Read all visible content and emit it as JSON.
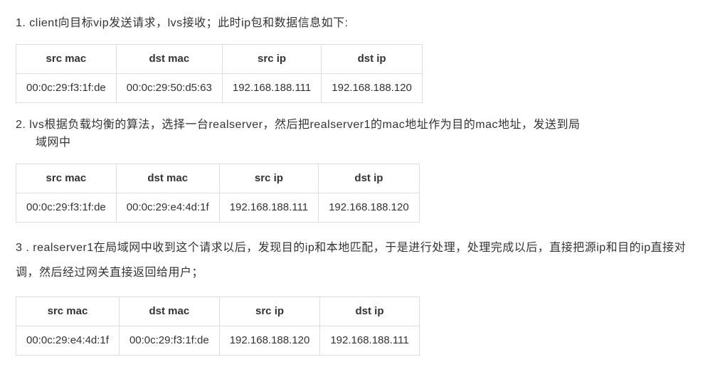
{
  "steps": [
    {
      "text": "1. client向目标vip发送请求，lvs接收；此时ip包和数据信息如下:",
      "text2": "",
      "headers": [
        "src mac",
        "dst mac",
        "src ip",
        "dst ip"
      ],
      "row": [
        "00:0c:29:f3:1f:de",
        "00:0c:29:50:d5:63",
        "192.168.188.111",
        "192.168.188.120"
      ]
    },
    {
      "text": "2. lvs根据负载均衡的算法，选择一台realserver，然后把realserver1的mac地址作为目的mac地址，发送到局",
      "text2": "域网中",
      "headers": [
        "src mac",
        "dst mac",
        "src ip",
        "dst ip"
      ],
      "row": [
        "00:0c:29:f3:1f:de",
        "00:0c:29:e4:4d:1f",
        "192.168.188.111",
        "192.168.188.120"
      ]
    },
    {
      "text": "3 . realserver1在局域网中收到这个请求以后，发现目的ip和本地匹配，于是进行处理，处理完成以后，直接把源ip和目的ip直接对调，然后经过网关直接返回给用户；",
      "text2": "",
      "headers": [
        "src mac",
        "dst mac",
        "src ip",
        "dst ip"
      ],
      "row": [
        "00:0c:29:e4:4d:1f",
        "00:0c:29:f3:1f:de",
        "192.168.188.120",
        "192.168.188.111"
      ]
    }
  ]
}
